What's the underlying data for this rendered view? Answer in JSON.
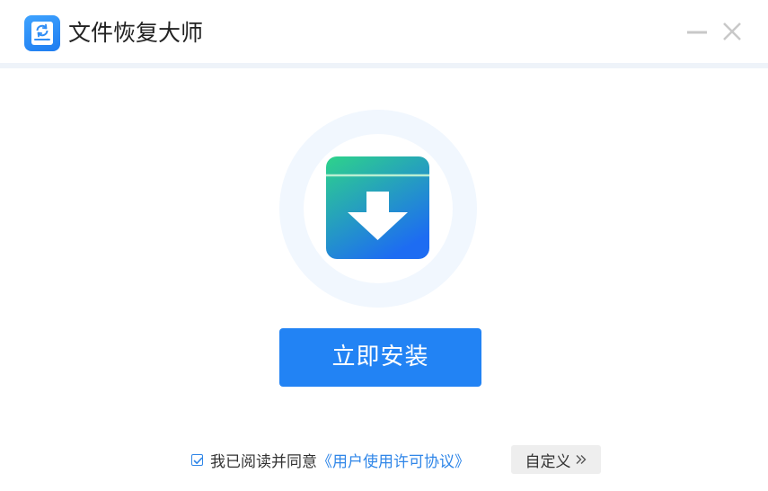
{
  "window": {
    "title": "文件恢复大师"
  },
  "icons": {
    "app": "disk-recovery-icon",
    "minimize": "minimize-icon",
    "close": "close-icon",
    "hero": "download-box-icon",
    "custom": "double-chevron-right-icon"
  },
  "main": {
    "install_label": "立即安装"
  },
  "agreement": {
    "checked": true,
    "prefix": "我已阅读并同意",
    "link": "《用户使用许可协议》"
  },
  "custom_button": {
    "label": "自定义"
  },
  "colors": {
    "accent": "#2283f4",
    "link": "#2f86e8",
    "hero_gradient_top": "#2ed38a",
    "hero_gradient_bottom": "#1d6cf2"
  }
}
